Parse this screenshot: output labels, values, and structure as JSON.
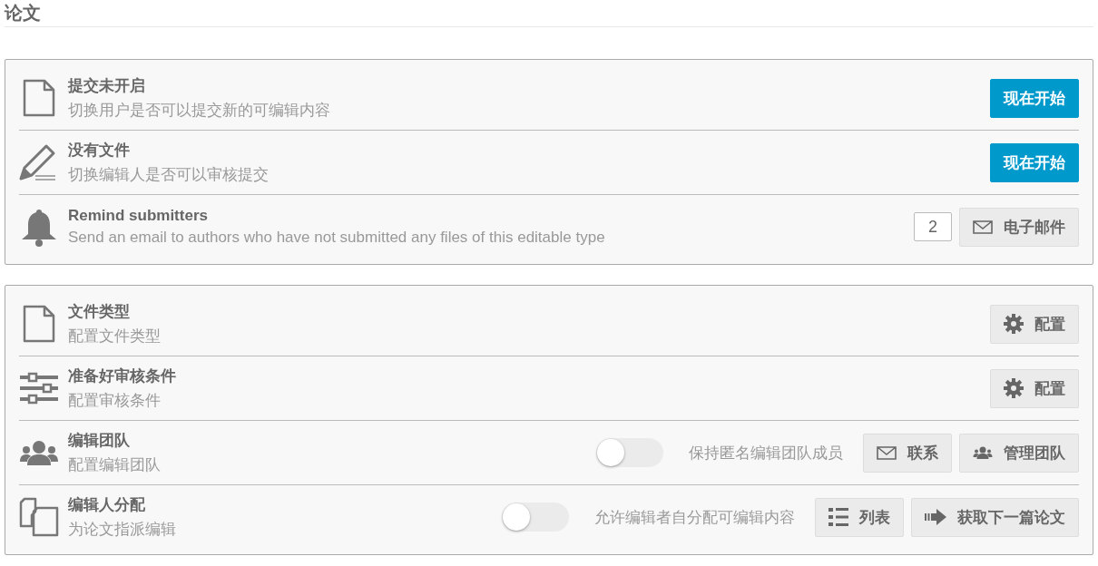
{
  "page_title": "论文",
  "panels": [
    {
      "rows": [
        {
          "kind": "file",
          "title": "提交未开启",
          "description": "切换用户是否可以提交新的可编辑内容",
          "buttons": [
            {
              "label": "现在开始",
              "kind": "plain",
              "primary": true
            }
          ]
        },
        {
          "kind": "pencil",
          "title": "没有文件",
          "description": "切换编辑人是否可以审核提交",
          "buttons": [
            {
              "label": "现在开始",
              "kind": "plain",
              "primary": true
            }
          ]
        },
        {
          "kind": "bell",
          "title": "Remind submitters",
          "description": "Send an email to authors who have not submitted any files of this editable type",
          "number_field": {
            "value": "2"
          },
          "buttons": [
            {
              "label": "电子邮件",
              "kind": "envelope",
              "primary": false
            }
          ]
        }
      ]
    },
    {
      "rows": [
        {
          "kind": "file",
          "title": "文件类型",
          "description": "配置文件类型",
          "buttons": [
            {
              "label": "配置",
              "kind": "gear",
              "primary": false
            }
          ]
        },
        {
          "kind": "sliders",
          "title": "准备好审核条件",
          "description": "配置审核条件",
          "buttons": [
            {
              "label": "配置",
              "kind": "gear",
              "primary": false
            }
          ]
        },
        {
          "kind": "team",
          "title": "编辑团队",
          "description": "配置编辑团队",
          "toggle": {
            "label": "保持匿名编辑团队成员",
            "on": false
          },
          "buttons": [
            {
              "label": "联系",
              "kind": "envelope",
              "primary": false
            },
            {
              "label": "管理团队",
              "kind": "team",
              "primary": false
            }
          ]
        },
        {
          "kind": "copy",
          "title": "编辑人分配",
          "description": "为论文指派编辑",
          "toggle": {
            "label": "允许编辑者自分配可编辑内容",
            "on": false
          },
          "buttons": [
            {
              "label": "列表",
              "kind": "list",
              "primary": false
            },
            {
              "label": "获取下一篇论文",
              "kind": "arrow",
              "primary": false
            }
          ]
        }
      ]
    }
  ]
}
